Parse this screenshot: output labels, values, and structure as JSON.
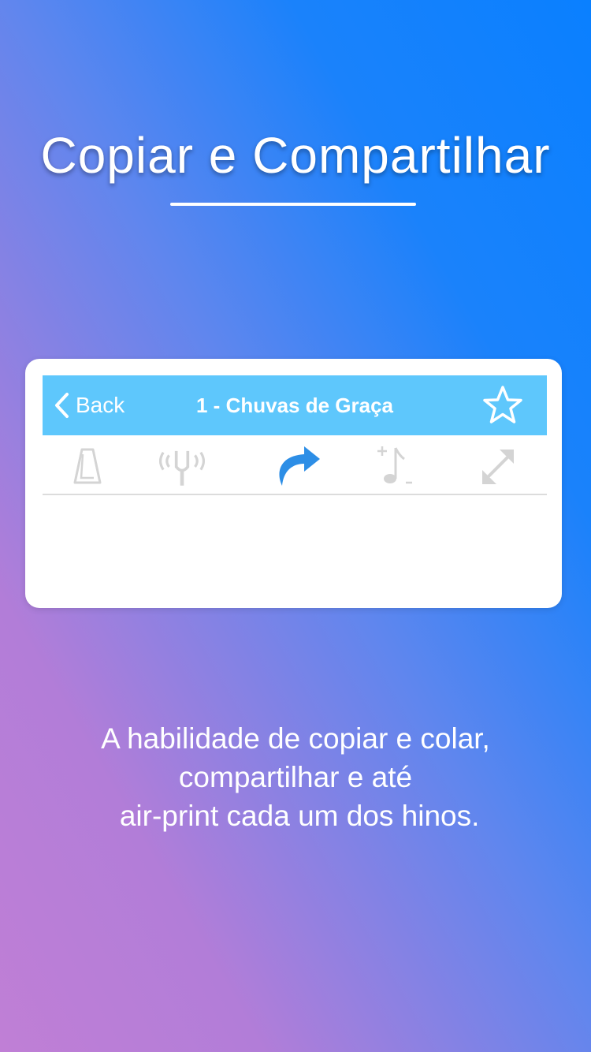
{
  "hero": {
    "title": "Copiar e Compartilhar"
  },
  "navbar": {
    "back_label": "Back",
    "title": "1 - Chuvas de Graça",
    "favorite_icon": "star-outline-icon"
  },
  "toolbar": {
    "items": [
      {
        "icon": "metronome-icon",
        "active": false
      },
      {
        "icon": "tuning-fork-icon",
        "active": false
      },
      {
        "icon": "share-arrow-icon",
        "active": true
      },
      {
        "icon": "transpose-note-icon",
        "active": false
      },
      {
        "icon": "expand-icon",
        "active": false
      }
    ]
  },
  "colors": {
    "navbar": "#5ec7fc",
    "active_icon": "#2d8ee6",
    "inactive_icon": "#d4d4d4",
    "text": "#ffffff"
  },
  "description": {
    "line1": "A habilidade de copiar e colar,",
    "line2": "compartilhar e até",
    "line3": " air-print cada um dos hinos."
  }
}
